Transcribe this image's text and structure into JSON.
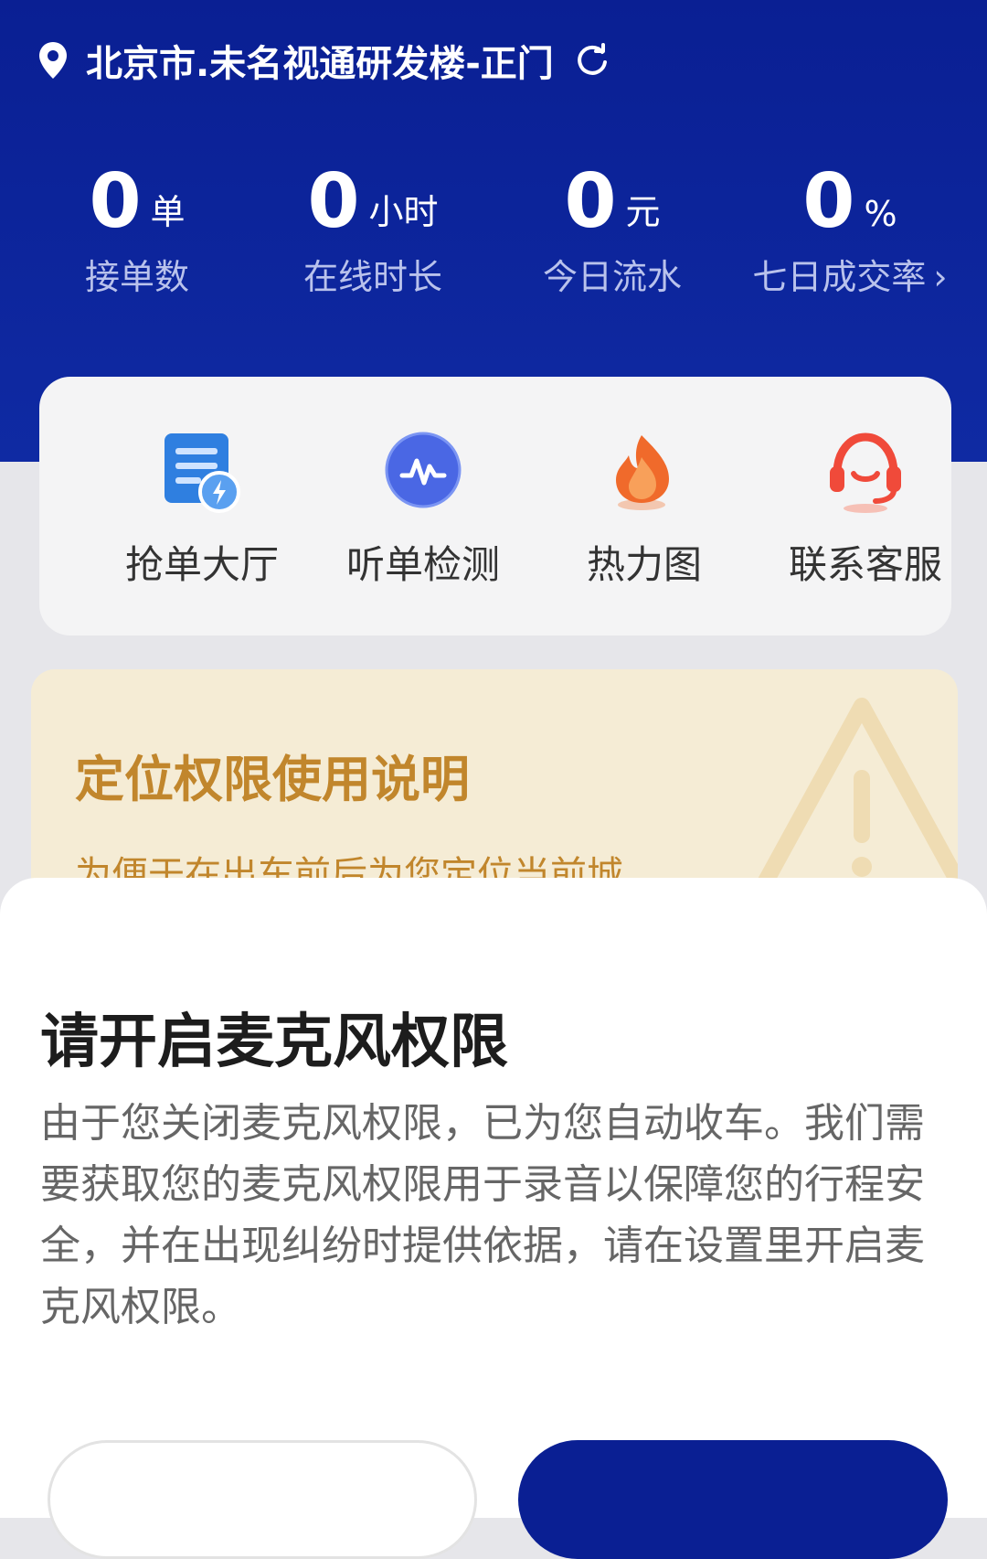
{
  "location": {
    "text": "北京市.未名视通研发楼-正门"
  },
  "stats": [
    {
      "value": "0",
      "unit": "单",
      "label": "接单数"
    },
    {
      "value": "0",
      "unit": "小时",
      "label": "在线时长"
    },
    {
      "value": "0",
      "unit": "元",
      "label": "今日流水"
    },
    {
      "value": "0",
      "unit": "%",
      "label": "七日成交率",
      "arrow": "›"
    }
  ],
  "tools": [
    {
      "label": "抢单大厅",
      "icon": "order-hall-icon",
      "color": "#2f7fe0"
    },
    {
      "label": "听单检测",
      "icon": "waveform-icon",
      "color": "#4a67e4"
    },
    {
      "label": "热力图",
      "icon": "flame-icon",
      "color": "#f06a2b"
    },
    {
      "label": "联系客服",
      "icon": "headset-icon",
      "color": "#f04a3a"
    }
  ],
  "notice": {
    "title": "定位权限使用说明",
    "body": "为便于在出车前后为您定位当前城"
  },
  "dialog": {
    "title": "请开启麦克风权限",
    "body": "由于您关闭麦克风权限，已为您自动收车。我们需要获取您的麦克风权限用于录音以保障您的行程安全，并在出现纠纷时提供依据，请在设置里开启麦克风权限。"
  },
  "colors": {
    "brand": "#0a1f93",
    "notice_text": "#c1862c",
    "notice_bg": "#f5ecd5"
  }
}
